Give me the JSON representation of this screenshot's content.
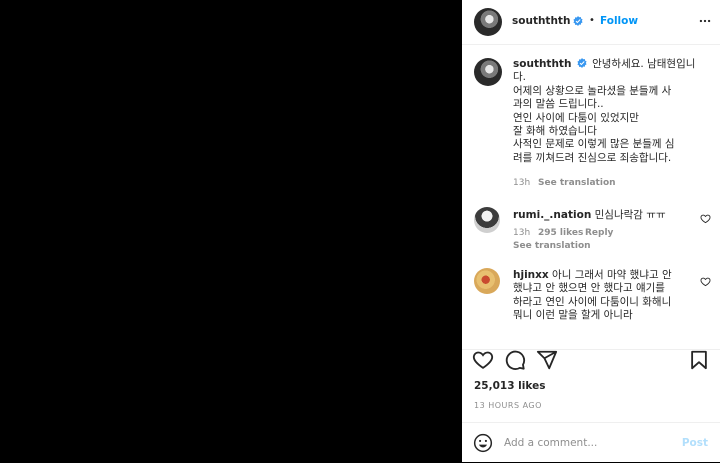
{
  "header": {
    "username": "souththth",
    "separator": "•",
    "follow_label": "Follow"
  },
  "caption": {
    "username": "souththth",
    "lines": [
      "안녕하세요. 남태현입니",
      "다.",
      "어제의 상황으로 놀라셨을 분들께 사",
      "과의 말씀 드립니다..",
      "연인 사이에 다툼이 있었지만",
      "잘 화해 하였습니다",
      "사적인 문제로 이렇게 많은 분들께 심",
      "려를 끼쳐드려 진심으로 죄송합니다."
    ],
    "time": "13h",
    "see_translation": "See translation"
  },
  "comments": [
    {
      "username": "rumi._.nation",
      "lines": [
        "민심나락감 ㅠㅠ"
      ],
      "time": "13h",
      "likes": "295 likes",
      "reply": "Reply",
      "see_translation": "See translation"
    },
    {
      "username": "hjinxx",
      "lines": [
        "아니 그래서 마약 했냐고 안",
        "했냐고 안 했으면 안 했다고 얘기를",
        "하라고 연인 사이에 다툼이니 화해니",
        "뭐니 이런 말을 할게 아니라"
      ]
    }
  ],
  "post": {
    "likes": "25,013 likes",
    "time_ago": "13 HOURS AGO"
  },
  "add_comment": {
    "placeholder": "Add a comment...",
    "post_label": "Post"
  },
  "colors": {
    "accent": "#0095f6",
    "post_disabled": "#b2dffc",
    "muted": "#8e8e8e",
    "text": "#262626",
    "background_media": "#000000"
  },
  "icons": [
    "verified-badge-icon",
    "more-options-icon",
    "heart-icon",
    "comment-icon",
    "share-icon",
    "bookmark-icon",
    "emoji-icon"
  ]
}
